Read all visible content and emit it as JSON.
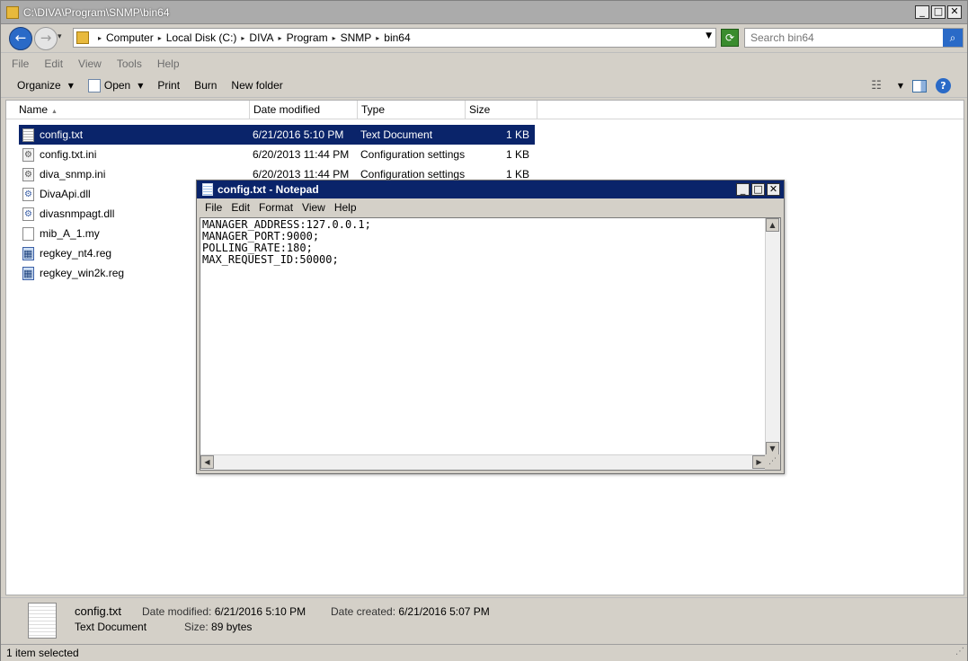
{
  "explorer": {
    "title": "C:\\DIVA\\Program\\SNMP\\bin64",
    "breadcrumbs": [
      "Computer",
      "Local Disk (C:)",
      "DIVA",
      "Program",
      "SNMP",
      "bin64"
    ],
    "search_placeholder": "Search bin64",
    "menu": [
      "File",
      "Edit",
      "View",
      "Tools",
      "Help"
    ],
    "toolbar": {
      "organize": "Organize",
      "open": "Open",
      "print": "Print",
      "burn": "Burn",
      "new_folder": "New folder"
    },
    "columns": {
      "name": "Name",
      "date_modified": "Date modified",
      "type": "Type",
      "size": "Size"
    },
    "files": [
      {
        "name": "config.txt",
        "date": "6/21/2016 5:10 PM",
        "type": "Text Document",
        "size": "1 KB",
        "icon": "text-document-icon"
      },
      {
        "name": "config.txt.ini",
        "date": "6/20/2013 11:44 PM",
        "type": "Configuration settings",
        "size": "1 KB",
        "icon": "settings-file-icon"
      },
      {
        "name": "diva_snmp.ini",
        "date": "6/20/2013 11:44 PM",
        "type": "Configuration settings",
        "size": "1 KB",
        "icon": "settings-file-icon"
      },
      {
        "name": "DivaApi.dll",
        "icon": "dll-file-icon"
      },
      {
        "name": "divasnmpagt.dll",
        "icon": "dll-file-icon"
      },
      {
        "name": "mib_A_1.my",
        "icon": "blank-file-icon"
      },
      {
        "name": "regkey_nt4.reg",
        "icon": "registry-file-icon"
      },
      {
        "name": "regkey_win2k.reg",
        "icon": "registry-file-icon"
      }
    ],
    "details": {
      "name": "config.txt",
      "type": "Text Document",
      "modified_label": "Date modified:",
      "modified_value": "6/21/2016 5:10 PM",
      "created_label": "Date created:",
      "created_value": "6/21/2016 5:07 PM",
      "size_label": "Size:",
      "size_value": "89 bytes"
    },
    "status": "1 item selected"
  },
  "notepad": {
    "title": "config.txt - Notepad",
    "menu": [
      "File",
      "Edit",
      "Format",
      "View",
      "Help"
    ],
    "content": "MANAGER_ADDRESS:127.0.0.1;\nMANAGER_PORT:9000;\nPOLLING_RATE:180;\nMAX_REQUEST_ID:50000;"
  },
  "colors": {
    "selection": "#0a246a",
    "notepad_titlebar": "#0a246a"
  }
}
